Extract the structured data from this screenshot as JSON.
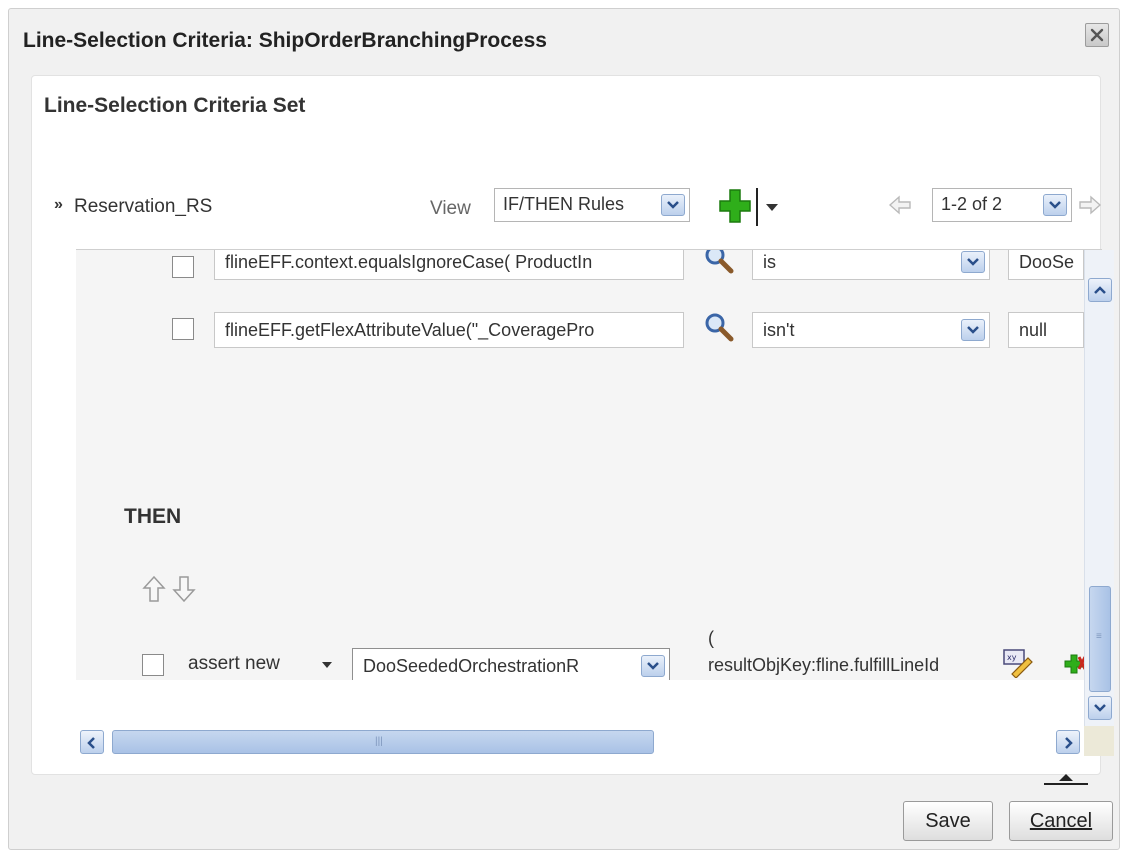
{
  "dialog": {
    "title": "Line-Selection Criteria: ShipOrderBranchingProcess",
    "close_icon": "close-icon"
  },
  "panel": {
    "title": "Line-Selection Criteria Set"
  },
  "toolbar": {
    "ruleset_name": "Reservation_RS",
    "view_label": "View",
    "view_value": "IF/THEN Rules",
    "pager_value": "1-2 of 2"
  },
  "conditions": [
    {
      "expression": "flineEFF.context.equalsIgnoreCase( ProductIn",
      "operator": "is",
      "value": "DooSe"
    },
    {
      "expression": "flineEFF.getFlexAttributeValue(\"_CoveragePro",
      "operator": "isn't",
      "value": "null"
    }
  ],
  "then": {
    "label": "THEN",
    "action": "assert new",
    "fact_type": "DooSeededOrchestrationR",
    "paren_open": "(",
    "expression": "resultObjKey:fline.fulfillLineId",
    "paren_close": ")"
  },
  "footer": {
    "save_label": "Save",
    "cancel_label": "Cancel"
  },
  "colors": {
    "accent_blue": "#a9c2e6",
    "add_green": "#2fae1a"
  }
}
